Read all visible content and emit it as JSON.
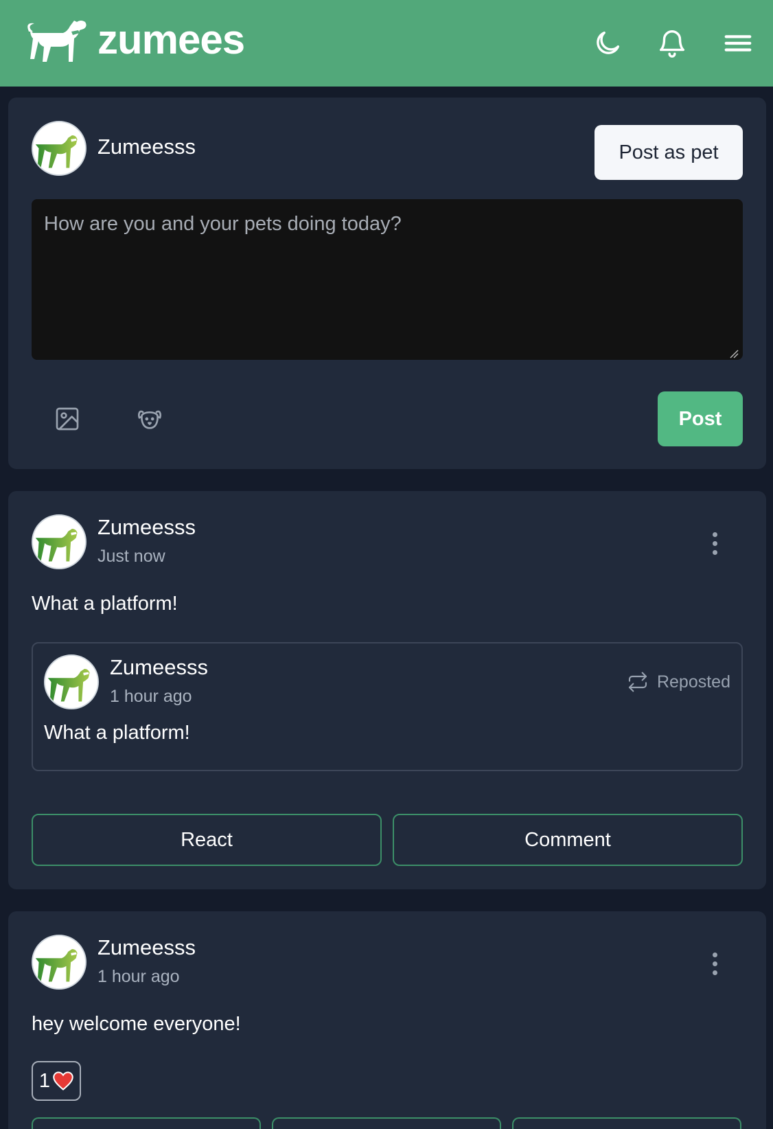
{
  "header": {
    "brand": "zumees",
    "icons": [
      "dog-logo-icon",
      "moon-icon",
      "bell-icon",
      "hamburger-menu-icon"
    ]
  },
  "composer": {
    "username": "Zumeesss",
    "post_as_pet_label": "Post as pet",
    "placeholder": "How are you and your pets doing today?",
    "value": "",
    "post_label": "Post",
    "tools": [
      "image-icon",
      "pet-face-icon"
    ]
  },
  "posts": [
    {
      "username": "Zumeesss",
      "time": "Just now",
      "text": "What a platform!",
      "repost": {
        "username": "Zumeesss",
        "time": "1 hour ago",
        "text": "What a platform!",
        "tag": "Reposted"
      },
      "actions": {
        "react": "React",
        "comment": "Comment"
      }
    },
    {
      "username": "Zumeesss",
      "time": "1 hour ago",
      "text": "hey welcome everyone!",
      "reaction_count": "1"
    }
  ],
  "colors": {
    "header_bg": "#52a87a",
    "page_bg": "#141b2a",
    "card_bg": "#212a3b",
    "accent": "#52b883",
    "heart": "#e53935"
  }
}
